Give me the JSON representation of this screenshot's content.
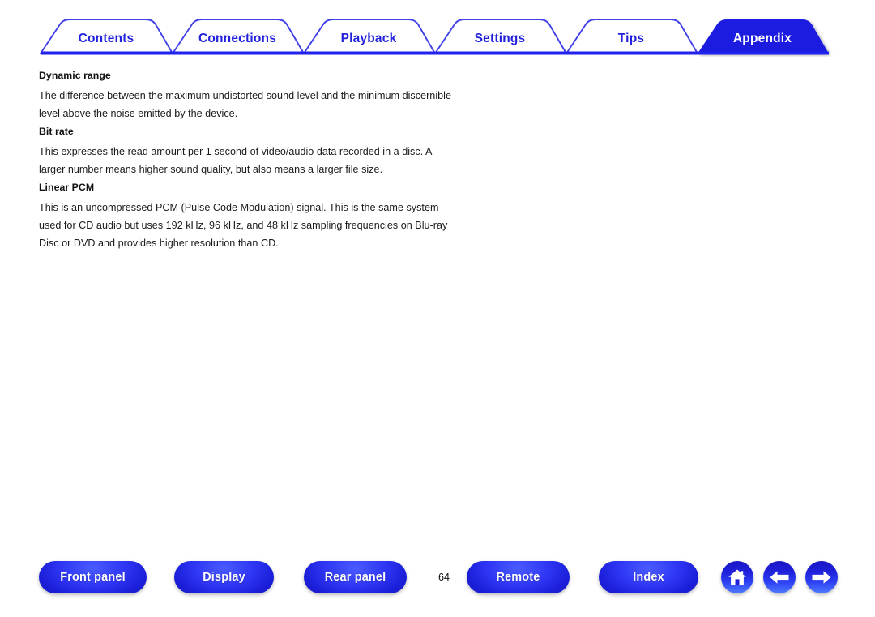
{
  "document": {
    "page_number": "64",
    "active_section": "Appendix"
  },
  "tabs": [
    {
      "label": "Contents",
      "active": false,
      "name": "tab-contents"
    },
    {
      "label": "Connections",
      "active": false,
      "name": "tab-connections"
    },
    {
      "label": "Playback",
      "active": false,
      "name": "tab-playback"
    },
    {
      "label": "Settings",
      "active": false,
      "name": "tab-settings"
    },
    {
      "label": "Tips",
      "active": false,
      "name": "tab-tips"
    },
    {
      "label": "Appendix",
      "active": true,
      "name": "tab-appendix"
    }
  ],
  "content": {
    "sections": [
      {
        "heading": "Dynamic range",
        "body": "The difference between the maximum undistorted sound level and the minimum discernible level above the noise emitted by the device."
      },
      {
        "heading": "Bit rate",
        "body": "This expresses the read amount per 1 second of video/audio data recorded in a disc. A larger number means higher sound quality, but also means a larger file size."
      },
      {
        "heading": "Linear PCM",
        "body": "This is an uncompressed PCM (Pulse Code Modulation) signal. This is the same system used for CD audio but uses 192 kHz, 96 kHz, and 48 kHz sampling frequencies on Blu-ray Disc or DVD and provides higher resolution than CD."
      }
    ]
  },
  "bottom_nav": {
    "buttons": [
      {
        "label": "Front panel",
        "name": "front-panel-button"
      },
      {
        "label": "Display",
        "name": "display-button"
      },
      {
        "label": "Rear panel",
        "name": "rear-panel-button"
      },
      {
        "label": "Remote",
        "name": "remote-button"
      },
      {
        "label": "Index",
        "name": "index-button"
      }
    ],
    "icons": [
      {
        "icon": "home-icon",
        "name": "home-button"
      },
      {
        "icon": "arrow-left-icon",
        "name": "previous-page-button"
      },
      {
        "icon": "arrow-right-icon",
        "name": "next-page-button"
      }
    ]
  },
  "colors": {
    "brand_blue": "#2222dd",
    "active_tab_fill": "#1a1ae0",
    "rule_blue": "#2222ee",
    "text": "#1a1a1a"
  }
}
